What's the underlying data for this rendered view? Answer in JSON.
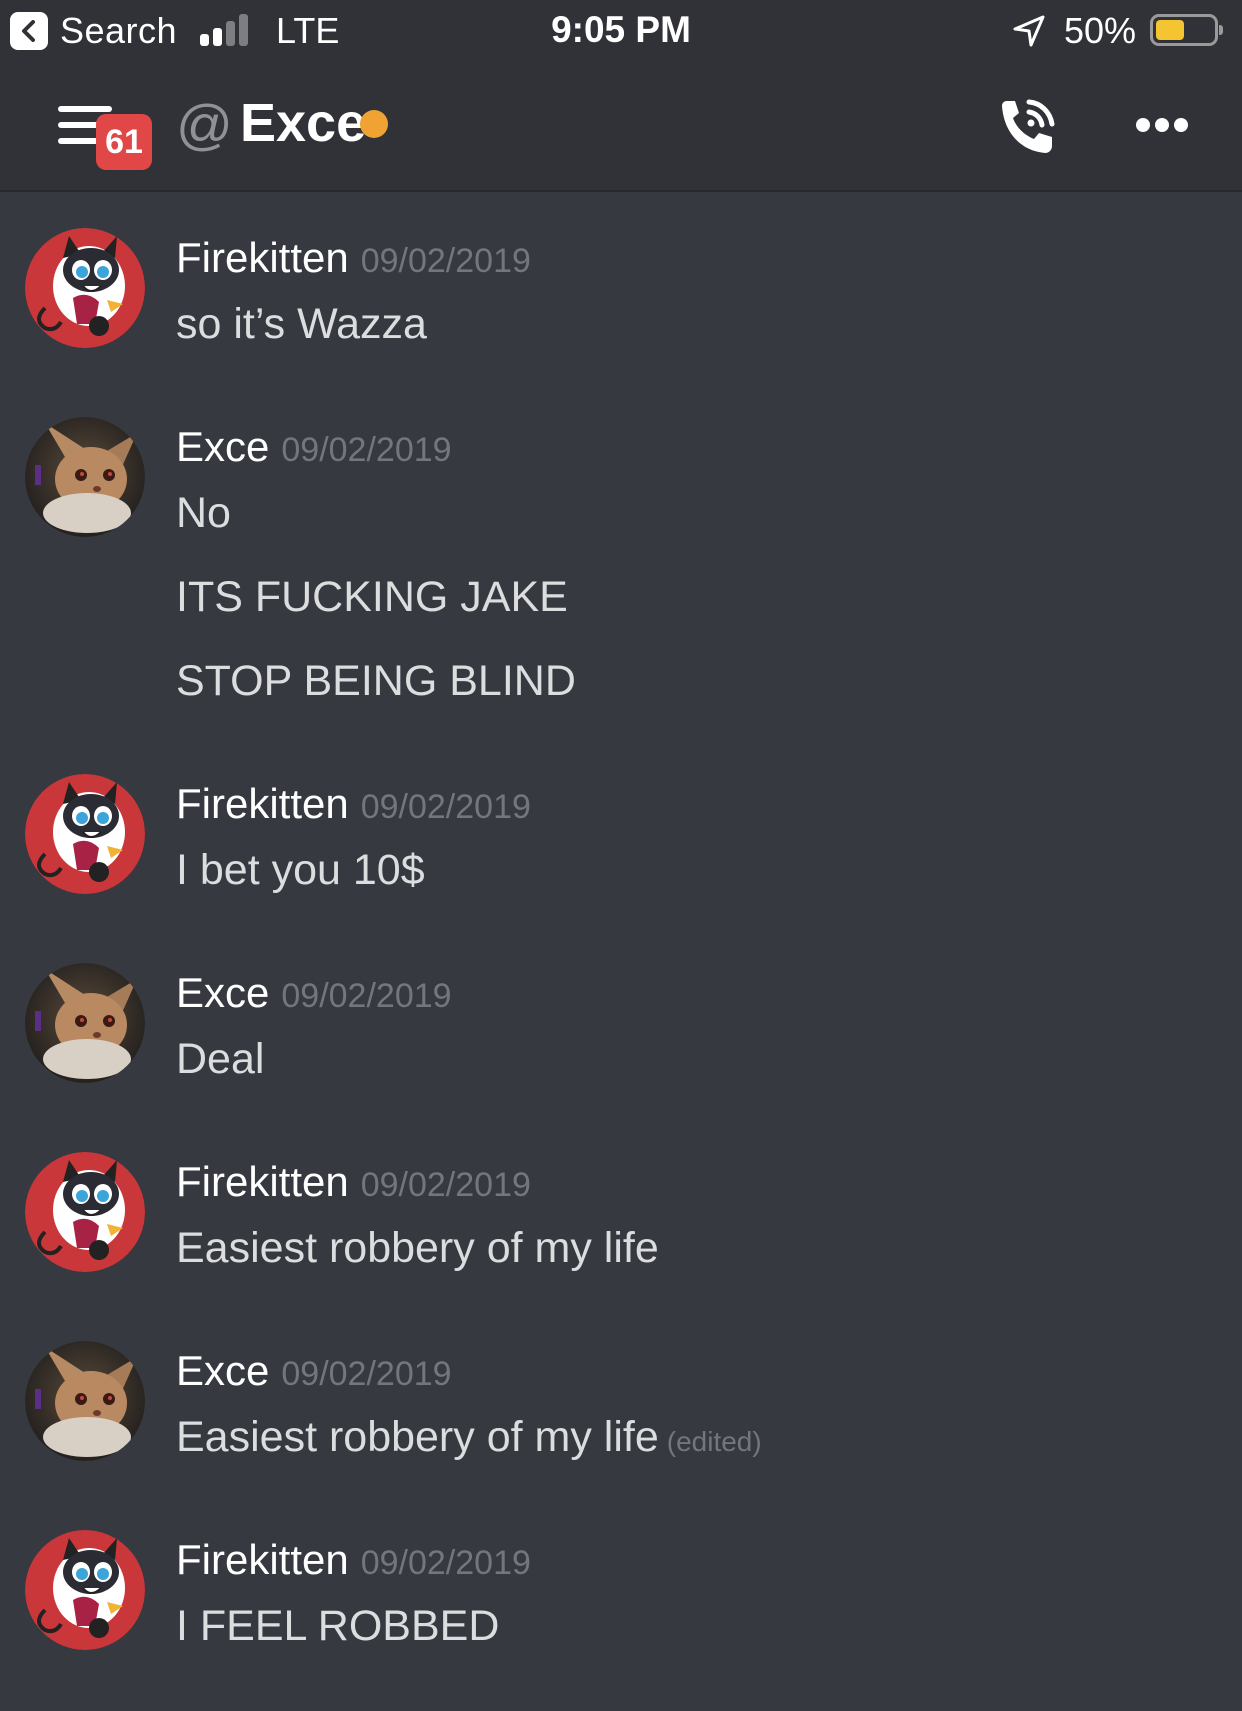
{
  "status_bar": {
    "back_label": "Search",
    "network": "LTE",
    "time": "9:05 PM",
    "battery": "50%",
    "battery_level": 0.5,
    "signal_bars_filled": 2,
    "signal_bars_total": 4
  },
  "header": {
    "unread_badge": "61",
    "at_symbol": "@",
    "channel_name": "Exce",
    "status_color": "#f0a232"
  },
  "messages": [
    {
      "author": "Firekitten",
      "timestamp": "09/02/2019",
      "lines": [
        "so it’s Wazza"
      ],
      "avatar": "firekitten-avatar"
    },
    {
      "author": "Exce",
      "timestamp": "09/02/2019",
      "lines": [
        "No",
        "ITS FUCKING JAKE",
        "STOP BEING BLIND"
      ],
      "avatar": "exce-avatar"
    },
    {
      "author": "Firekitten",
      "timestamp": "09/02/2019",
      "lines": [
        "I bet you 10$"
      ],
      "avatar": "firekitten-avatar"
    },
    {
      "author": "Exce",
      "timestamp": "09/02/2019",
      "lines": [
        "Deal"
      ],
      "avatar": "exce-avatar"
    },
    {
      "author": "Firekitten",
      "timestamp": "09/02/2019",
      "lines": [
        "Easiest robbery of my life"
      ],
      "avatar": "firekitten-avatar"
    },
    {
      "author": "Exce",
      "timestamp": "09/02/2019",
      "lines": [
        "Easiest robbery of my life"
      ],
      "edited_label": "(edited)",
      "avatar": "exce-avatar"
    },
    {
      "author": "Firekitten",
      "timestamp": "09/02/2019",
      "lines": [
        "I FEEL ROBBED"
      ],
      "avatar": "firekitten-avatar"
    }
  ],
  "colors": {
    "background": "#36393f",
    "header": "#303237",
    "timestamp": "#72767d",
    "badge": "#e24747",
    "battery_fill": "#f5c431"
  }
}
